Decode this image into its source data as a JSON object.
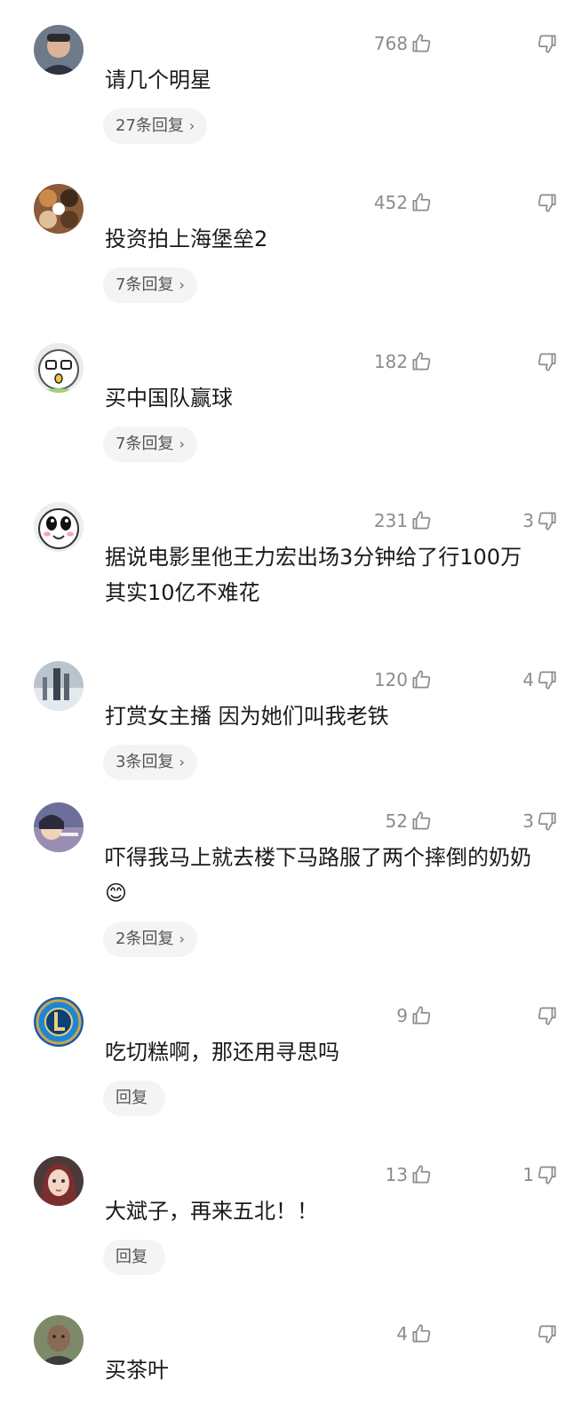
{
  "comments": [
    {
      "likes": "768",
      "dislikes": "",
      "text": "请几个明星",
      "replies": "27条回复",
      "chevron": "›",
      "avatar": "person-photo-avatar"
    },
    {
      "likes": "452",
      "dislikes": "",
      "text": "投资拍上海堡垒2",
      "replies": "7条回复",
      "chevron": "›",
      "avatar": "dogs-photo-avatar"
    },
    {
      "likes": "182",
      "dislikes": "",
      "text": "买中国队赢球",
      "replies": "7条回复",
      "chevron": "›",
      "avatar": "cartoon-face-avatar"
    },
    {
      "likes": "231",
      "dislikes": "3",
      "text": "据说电影里他王力宏出场3分钟给了行100万　其实10亿不难花",
      "replies": "",
      "chevron": "",
      "avatar": "cartoon-face-avatar"
    },
    {
      "likes": "120",
      "dislikes": "4",
      "text": "打赏女主播 因为她们叫我老铁",
      "replies": "3条回复",
      "chevron": "›",
      "avatar": "winter-scene-avatar"
    },
    {
      "likes": "52",
      "dislikes": "3",
      "text": "吓得我马上就去楼下马路服了两个摔倒的奶奶😊",
      "replies": "2条回复",
      "chevron": "›",
      "avatar": "anime-avatar"
    },
    {
      "likes": "9",
      "dislikes": "",
      "text": "吃切糕啊，那还用寻思吗",
      "replies": "回复",
      "chevron": "",
      "avatar": "league-logo-avatar"
    },
    {
      "likes": "13",
      "dislikes": "1",
      "text": "大斌子，再来五北！！",
      "replies": "回复",
      "chevron": "",
      "avatar": "girl-portrait-avatar"
    },
    {
      "likes": "4",
      "dislikes": "",
      "text": "买茶叶",
      "replies": "",
      "chevron": "",
      "avatar": "man-photo-avatar"
    }
  ],
  "colors": {
    "text": "#1a1a1a",
    "meta": "#8c8c8c",
    "reply_bg": "#f4f4f4",
    "reply_text": "#555555"
  }
}
